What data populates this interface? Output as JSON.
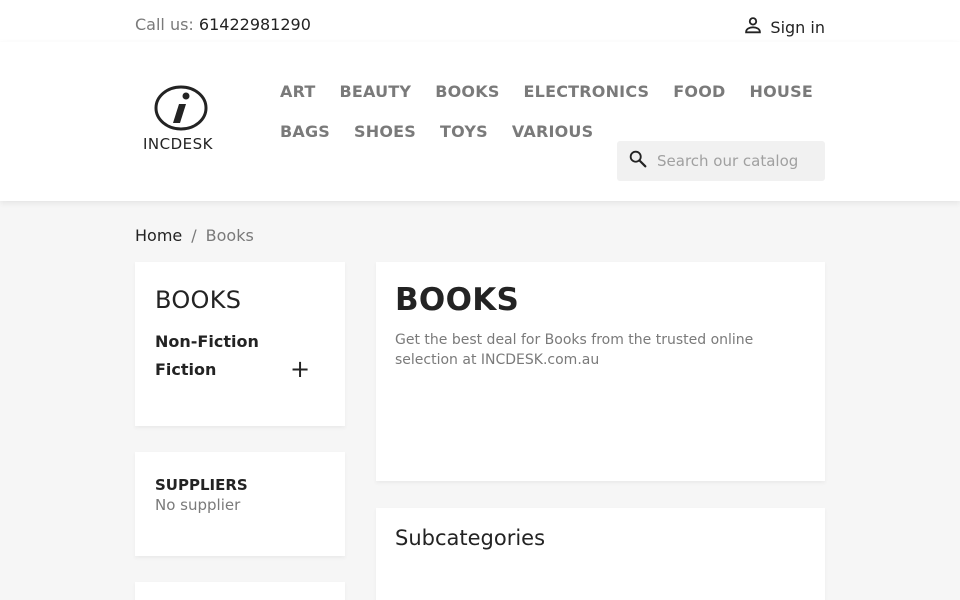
{
  "topbar": {
    "call_label": "Call us:",
    "phone": "61422981290",
    "signin_label": "Sign in"
  },
  "logo": {
    "wordmark": "INCDESK"
  },
  "nav": {
    "row1": [
      "ART",
      "BEAUTY",
      "BOOKS",
      "ELECTRONICS",
      "FOOD",
      "HOUSE"
    ],
    "row2": [
      "BAGS",
      "SHOES",
      "TOYS",
      "VARIOUS"
    ]
  },
  "search": {
    "placeholder": "Search our catalog"
  },
  "breadcrumb": {
    "home": "Home",
    "separator": "/",
    "current": "Books"
  },
  "category_block": {
    "title": "BOOKS",
    "items": [
      {
        "label": "Non-Fiction"
      },
      {
        "label": "Fiction"
      }
    ],
    "expand_symbol": "+"
  },
  "suppliers": {
    "title": "SUPPLIERS",
    "value": "No supplier"
  },
  "main": {
    "title": "BOOKS",
    "description": "Get the best deal for Books from the trusted online selection at INCDESK.com.au"
  },
  "subcategories": {
    "title": "Subcategories"
  },
  "colors": {
    "text_dark": "#232323",
    "text_muted": "#7a7a7a",
    "background": "#f6f6f6",
    "card": "#ffffff"
  }
}
